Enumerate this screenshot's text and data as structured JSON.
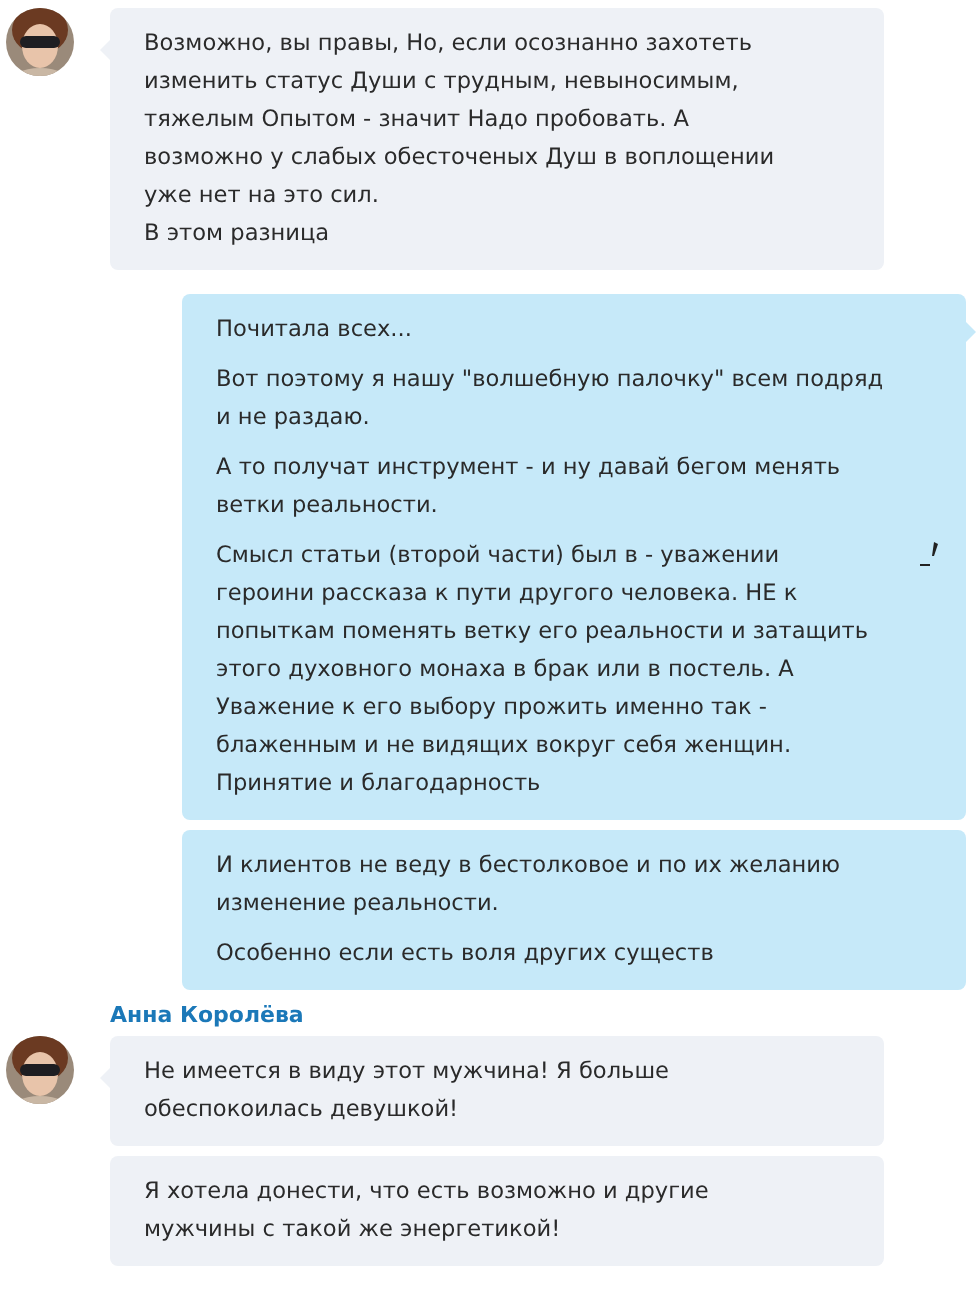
{
  "messages": [
    {
      "kind": "incoming",
      "bubbles": [
        {
          "edited": false,
          "paragraphs": [
            "Возможно, вы правы, Но, если осознанно захотеть изменить статус  Души с трудным, невыносимым, тяжелым Опытом - значит Надо пробовать. А возможно у слабых обесточеных Душ в воплощении уже нет на это сил.\nВ этом разница"
          ]
        }
      ]
    },
    {
      "kind": "outgoing",
      "bubbles": [
        {
          "edited": true,
          "paragraphs": [
            "Почитала всех...",
            "Вот поэтому я нашу \"волшебную палочку\" всем подряд и не раздаю.",
            "А то получат инструмент - и ну давай бегом менять ветки реальности.",
            "Смысл статьи (второй части) был в - уважении героини рассказа к пути другого человека. НЕ к попыткам поменять ветку его реальности и затащить этого духовного монаха в брак или в постель. А  Уважение к его выбору прожить именно так - блаженным и не видящих вокруг себя женщин. Принятие и благодарность"
          ]
        },
        {
          "edited": false,
          "paragraphs": [
            "И клиентов не веду в бестолковое и по их желанию изменение реальности.",
            "Особенно если есть воля других существ"
          ]
        }
      ]
    },
    {
      "kind": "incoming",
      "sender": "Анна Королёва",
      "bubbles": [
        {
          "edited": false,
          "paragraphs": [
            "Не имеется в виду этот мужчина! Я больше обеспокоилась девушкой!"
          ]
        },
        {
          "edited": false,
          "paragraphs": [
            "Я хотела донести, что есть возможно и другие мужчины с такой же энергетикой!"
          ]
        }
      ]
    }
  ]
}
